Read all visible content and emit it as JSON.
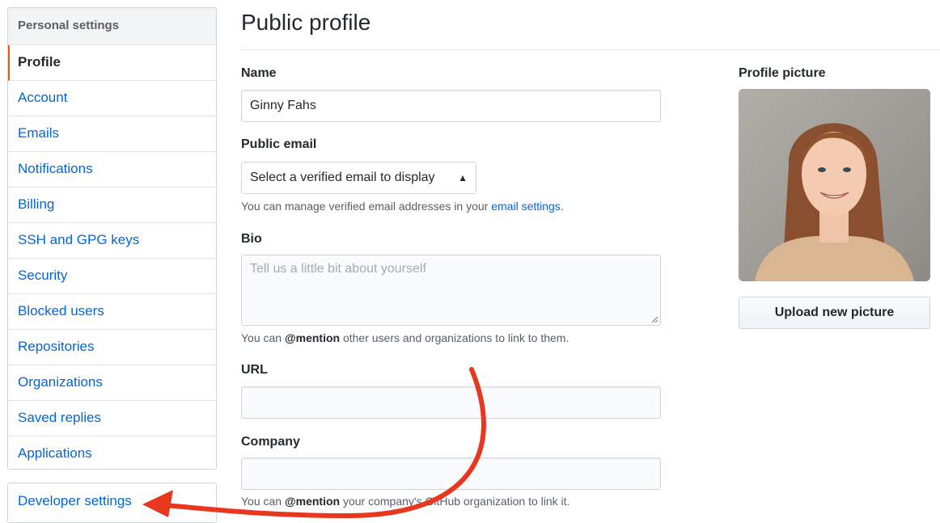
{
  "sidebar": {
    "header": "Personal settings",
    "items": [
      {
        "label": "Profile"
      },
      {
        "label": "Account"
      },
      {
        "label": "Emails"
      },
      {
        "label": "Notifications"
      },
      {
        "label": "Billing"
      },
      {
        "label": "SSH and GPG keys"
      },
      {
        "label": "Security"
      },
      {
        "label": "Blocked users"
      },
      {
        "label": "Repositories"
      },
      {
        "label": "Organizations"
      },
      {
        "label": "Saved replies"
      },
      {
        "label": "Applications"
      }
    ],
    "developer": "Developer settings"
  },
  "page": {
    "title": "Public profile"
  },
  "form": {
    "name_label": "Name",
    "name_value": "Ginny Fahs",
    "email_label": "Public email",
    "email_select": "Select a verified email to display",
    "email_note_prefix": "You can manage verified email addresses in your ",
    "email_note_link": "email settings",
    "email_note_suffix": ".",
    "bio_label": "Bio",
    "bio_placeholder": "Tell us a little bit about yourself",
    "bio_note_prefix": "You can ",
    "bio_note_mention": "@mention",
    "bio_note_suffix": " other users and organizations to link to them.",
    "url_label": "URL",
    "url_value": "",
    "company_label": "Company",
    "company_value": "",
    "company_note_prefix": "You can ",
    "company_note_mention": "@mention",
    "company_note_suffix": " your company's GitHub organization to link it."
  },
  "profile_picture": {
    "label": "Profile picture",
    "upload_label": "Upload new picture"
  },
  "colors": {
    "link": "#0366d6",
    "active_marker": "#e36209",
    "annotation_arrow": "#e8361f"
  }
}
